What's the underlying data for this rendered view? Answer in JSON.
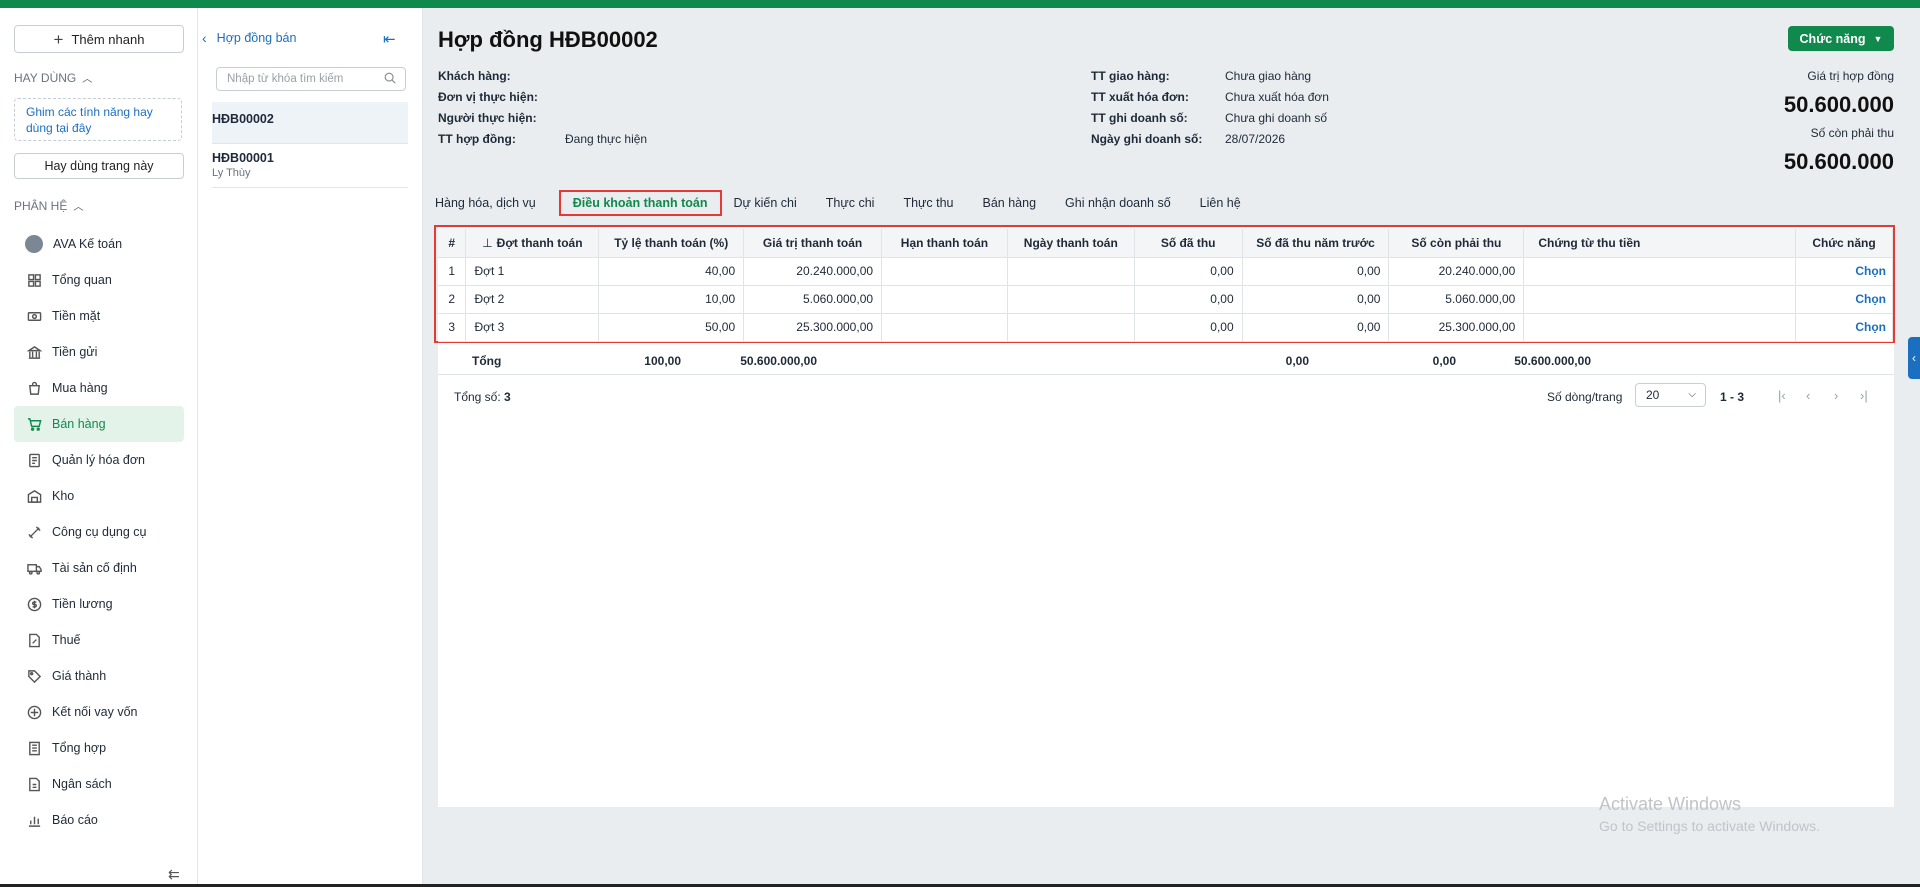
{
  "nav": {
    "quick_add": "Thêm nhanh",
    "section_favorites": "HAY DÙNG",
    "pin_hint": "Ghim các tính năng hay dùng tại đây",
    "favorite_button": "Hay dùng trang này",
    "section_modules": "PHÂN HỆ",
    "items": [
      {
        "label": "AVA Kế toán",
        "icon": "ava-avatar"
      },
      {
        "label": "Tổng quan",
        "icon": "dashboard-icon"
      },
      {
        "label": "Tiền mặt",
        "icon": "cash-icon"
      },
      {
        "label": "Tiền gửi",
        "icon": "bank-icon"
      },
      {
        "label": "Mua hàng",
        "icon": "bag-icon"
      },
      {
        "label": "Bán hàng",
        "icon": "cart-icon"
      },
      {
        "label": "Quản lý hóa đơn",
        "icon": "invoice-icon"
      },
      {
        "label": "Kho",
        "icon": "warehouse-icon"
      },
      {
        "label": "Công cụ dụng cụ",
        "icon": "tools-icon"
      },
      {
        "label": "Tài sản cố định",
        "icon": "truck-icon"
      },
      {
        "label": "Tiền lương",
        "icon": "salary-icon"
      },
      {
        "label": "Thuế",
        "icon": "tax-icon"
      },
      {
        "label": "Giá thành",
        "icon": "price-tag-icon"
      },
      {
        "label": "Kết nối vay vốn",
        "icon": "loan-icon"
      },
      {
        "label": "Tổng hợp",
        "icon": "summary-icon"
      },
      {
        "label": "Ngân sách",
        "icon": "budget-icon"
      },
      {
        "label": "Báo cáo",
        "icon": "report-icon"
      }
    ],
    "active_item": "Bán hàng"
  },
  "list_panel": {
    "back_label": "Hợp đồng bán",
    "search_placeholder": "Nhập từ khóa tìm kiếm",
    "items": [
      {
        "code": "HĐB00002",
        "sub": ""
      },
      {
        "code": "HĐB00001",
        "sub": "Ly Thùy"
      }
    ]
  },
  "header": {
    "title": "Hợp đồng HĐB00002",
    "function_button": "Chức năng",
    "left_info": [
      {
        "label": "Khách hàng:",
        "value": ""
      },
      {
        "label": "Đơn vị thực hiện:",
        "value": ""
      },
      {
        "label": "Người thực hiện:",
        "value": ""
      },
      {
        "label": "TT hợp đồng:",
        "value": "Đang thực hiện"
      }
    ],
    "right_info": [
      {
        "label": "TT giao hàng:",
        "value": "Chưa giao hàng"
      },
      {
        "label": "TT xuất hóa đơn:",
        "value": "Chưa xuất hóa đơn"
      },
      {
        "label": "TT ghi doanh số:",
        "value": "Chưa ghi doanh số"
      },
      {
        "label": "Ngày ghi doanh số:",
        "value": "28/07/2026"
      }
    ],
    "contract_value_label": "Giá trị hợp đồng",
    "contract_value": "50.600.000",
    "remaining_label": "Số còn phải thu",
    "remaining_value": "50.600.000"
  },
  "tabs": [
    "Hàng hóa, dịch vụ",
    "Điều khoản thanh toán",
    "Dự kiến chi",
    "Thực chi",
    "Thực thu",
    "Bán hàng",
    "Ghi nhận doanh số",
    "Liên hệ"
  ],
  "active_tab": "Điều khoản thanh toán",
  "grid": {
    "columns": [
      "#",
      "Đợt thanh toán",
      "Tỷ lệ thanh toán (%)",
      "Giá trị thanh toán",
      "Hạn thanh toán",
      "Ngày thanh toán",
      "Số đã thu",
      "Số đã thu năm trước",
      "Số còn phải thu",
      "Chứng từ thu tiền",
      "Chức năng"
    ],
    "rows": [
      [
        "1",
        "Đợt 1",
        "40,00",
        "20.240.000,00",
        "",
        "",
        "0,00",
        "0,00",
        "20.240.000,00",
        "",
        "Chọn"
      ],
      [
        "2",
        "Đợt 2",
        "10,00",
        "5.060.000,00",
        "",
        "",
        "0,00",
        "0,00",
        "5.060.000,00",
        "",
        "Chọn"
      ],
      [
        "3",
        "Đợt 3",
        "50,00",
        "25.300.000,00",
        "",
        "",
        "0,00",
        "0,00",
        "25.300.000,00",
        "",
        "Chọn"
      ]
    ],
    "totals": {
      "label": "Tổng",
      "rate": "100,00",
      "amount": "50.600.000,00",
      "collected": "0,00",
      "collected_prev": "0,00",
      "remaining": "50.600.000,00"
    }
  },
  "footer": {
    "total_label": "Tổng số:",
    "total_count": "3",
    "page_size_label": "Số dòng/trang",
    "page_size": "20",
    "range": "1 - 3"
  },
  "watermark": {
    "line1": "Activate Windows",
    "line2": "Go to Settings to activate Windows."
  },
  "colors": {
    "brand": "#0f8a4c",
    "link": "#1b6fc0",
    "highlight": "#e53935"
  }
}
